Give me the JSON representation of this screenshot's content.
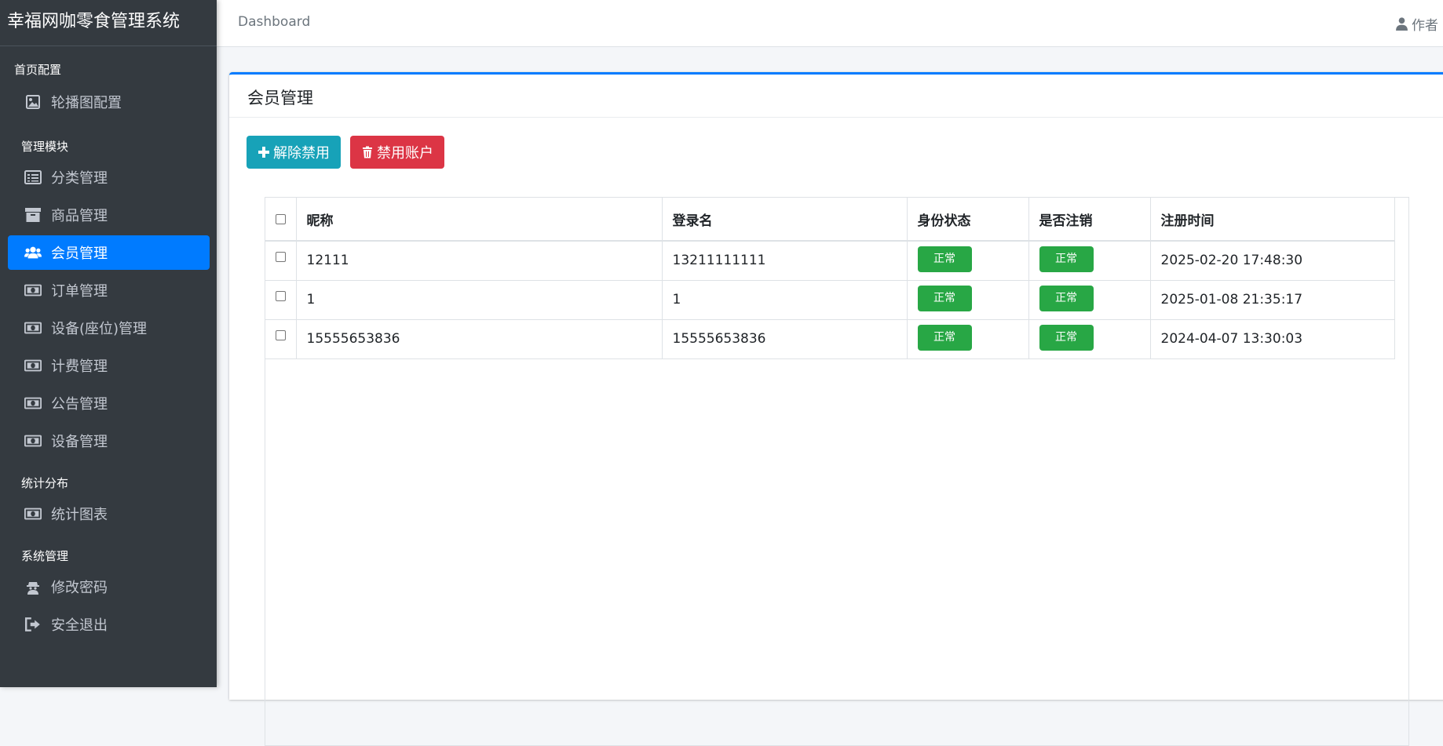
{
  "brand": {
    "title": "幸福网咖零食管理系统"
  },
  "topbar": {
    "breadcrumb": "Dashboard",
    "user": "作者"
  },
  "sidebar": {
    "groups": [
      {
        "header": "首页配置",
        "items": [
          {
            "label": "轮播图配置",
            "icon": "image-icon"
          }
        ]
      },
      {
        "header": "管理模块",
        "items": [
          {
            "label": "分类管理",
            "icon": "list-icon"
          },
          {
            "label": "商品管理",
            "icon": "archive-icon"
          },
          {
            "label": "会员管理",
            "icon": "users-icon",
            "active": true
          },
          {
            "label": "订单管理",
            "icon": "money-icon"
          },
          {
            "label": "设备(座位)管理",
            "icon": "money-icon"
          },
          {
            "label": "计费管理",
            "icon": "money-icon"
          },
          {
            "label": "公告管理",
            "icon": "money-icon"
          },
          {
            "label": "设备管理",
            "icon": "money-icon"
          }
        ]
      },
      {
        "header": "统计分布",
        "items": [
          {
            "label": "统计图表",
            "icon": "money-icon"
          }
        ]
      },
      {
        "header": "系统管理",
        "items": [
          {
            "label": "修改密码",
            "icon": "user-secret-icon"
          },
          {
            "label": "安全退出",
            "icon": "sign-out-icon"
          }
        ]
      }
    ]
  },
  "card": {
    "title": "会员管理",
    "buttons": {
      "unban": "解除禁用",
      "ban": "禁用账户"
    }
  },
  "table": {
    "columns": [
      "昵称",
      "登录名",
      "身份状态",
      "是否注销",
      "注册时间"
    ],
    "rows": [
      {
        "nickname": "12111",
        "login": "13211111111",
        "status": "正常",
        "cancelled": "正常",
        "registered": "2025-02-20 17:48:30"
      },
      {
        "nickname": "1",
        "login": "1",
        "status": "正常",
        "cancelled": "正常",
        "registered": "2025-01-08 21:35:17"
      },
      {
        "nickname": "15555653836",
        "login": "15555653836",
        "status": "正常",
        "cancelled": "正常",
        "registered": "2024-04-07 13:30:03"
      }
    ]
  },
  "colors": {
    "sidebar": "#343a40",
    "active": "#007bff",
    "info": "#17a2b8",
    "danger": "#dc3545",
    "success": "#28a745"
  }
}
